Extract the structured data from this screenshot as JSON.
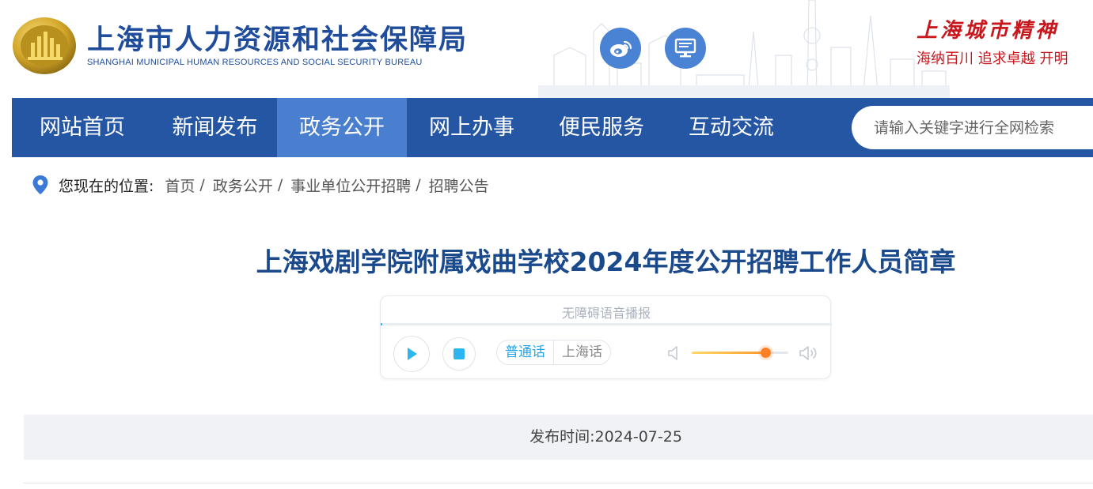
{
  "header": {
    "site_title": "上海市人力资源和社会保障局",
    "site_subtitle": "SHANGHAI MUNICIPAL HUMAN RESOURCES AND SOCIAL SECURITY BUREAU",
    "spirit_title": "上海城市精神",
    "spirit_motto": "海纳百川 追求卓越 开明"
  },
  "nav": {
    "items": [
      {
        "label": "网站首页"
      },
      {
        "label": "新闻发布"
      },
      {
        "label": "政务公开"
      },
      {
        "label": "网上办事"
      },
      {
        "label": "便民服务"
      },
      {
        "label": "互动交流"
      }
    ],
    "active_index": 2,
    "search_placeholder": "请输入关键字进行全网检索"
  },
  "breadcrumb": {
    "label": "您现在的位置:",
    "items": [
      "首页",
      "政务公开",
      "事业单位公开招聘",
      "招聘公告"
    ],
    "separator": "/"
  },
  "article": {
    "title": "上海戏剧学院附属戏曲学校2024年度公开招聘工作人员简章",
    "publish_label": "发布时间:",
    "publish_date": "2024-07-25"
  },
  "player": {
    "label": "无障碍语音播报",
    "progress": 0,
    "languages": [
      "普通话",
      "上海话"
    ],
    "selected_language": "普通话",
    "volume": 0.76
  },
  "colors": {
    "brand_blue": "#2556a4",
    "nav_active": "#4a7fd0",
    "title_blue": "#1a4a8c",
    "spirit_red": "#c9171e",
    "accent_cyan": "#1fa6e8"
  },
  "icons": [
    "emblem-logo",
    "weibo-icon",
    "desktop-icon",
    "location-pin-icon",
    "play-icon",
    "stop-icon",
    "volume-low-icon",
    "volume-high-icon"
  ]
}
